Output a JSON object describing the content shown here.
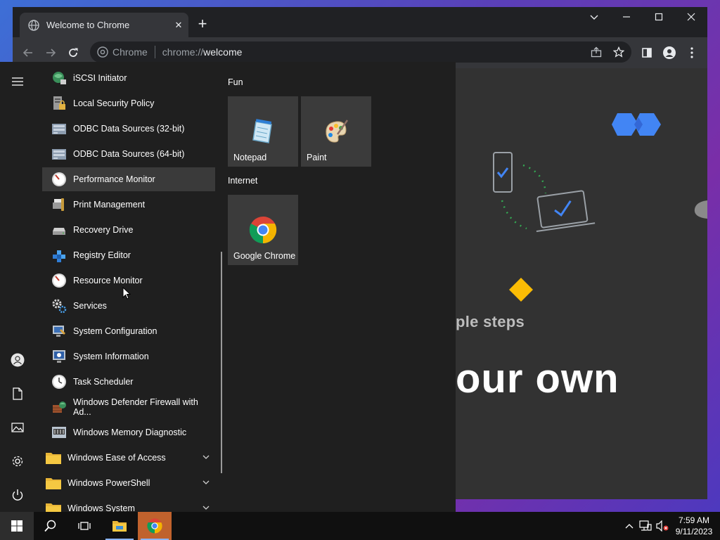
{
  "browser": {
    "tab_title": "Welcome to Chrome",
    "omnibox_site": "Chrome",
    "url_scheme": "chrome://",
    "url_host": "welcome",
    "icons": [
      "globe-icon",
      "close-icon",
      "plus-icon",
      "chevron-down-icon",
      "minimize-icon",
      "maximize-icon",
      "close-window-icon",
      "back-icon",
      "forward-icon",
      "reload-icon",
      "share-icon",
      "star-icon",
      "side-panel-icon",
      "profile-icon",
      "kebab-menu-icon"
    ]
  },
  "page": {
    "text_line1": "ple steps",
    "text_line2": "our own",
    "accent_blue": "#4285f4",
    "accent_yellow": "#fbbc04"
  },
  "start_menu": {
    "apps": [
      {
        "label": "iSCSI Initiator",
        "icon": "globe-network-icon"
      },
      {
        "label": "Local Security Policy",
        "icon": "security-policy-icon"
      },
      {
        "label": "ODBC Data Sources (32-bit)",
        "icon": "database-icon"
      },
      {
        "label": "ODBC Data Sources (64-bit)",
        "icon": "database-icon"
      },
      {
        "label": "Performance Monitor",
        "icon": "gauge-icon"
      },
      {
        "label": "Print Management",
        "icon": "printer-icon"
      },
      {
        "label": "Recovery Drive",
        "icon": "drive-icon"
      },
      {
        "label": "Registry Editor",
        "icon": "registry-icon"
      },
      {
        "label": "Resource Monitor",
        "icon": "gauge-icon"
      },
      {
        "label": "Services",
        "icon": "gear-icon"
      },
      {
        "label": "System Configuration",
        "icon": "monitor-icon"
      },
      {
        "label": "System Information",
        "icon": "info-monitor-icon"
      },
      {
        "label": "Task Scheduler",
        "icon": "clock-icon"
      },
      {
        "label": "Windows Defender Firewall with Ad...",
        "icon": "firewall-icon"
      },
      {
        "label": "Windows Memory Diagnostic",
        "icon": "memory-icon"
      }
    ],
    "folders": [
      {
        "label": "Windows Ease of Access"
      },
      {
        "label": "Windows PowerShell"
      },
      {
        "label": "Windows System"
      }
    ],
    "groups": [
      {
        "label": "Fun",
        "tiles": [
          {
            "label": "Notepad"
          },
          {
            "label": "Paint"
          }
        ]
      },
      {
        "label": "Internet",
        "tiles": [
          {
            "label": "Google Chrome"
          }
        ]
      }
    ],
    "rail_icons": [
      "hamburger-menu-icon",
      "user-icon",
      "document-icon",
      "pictures-icon",
      "settings-icon",
      "power-icon"
    ]
  },
  "taskbar": {
    "time": "7:59 AM",
    "date": "9/11/2023",
    "icons": [
      "windows-start-icon",
      "search-icon",
      "task-view-icon",
      "file-explorer-icon",
      "chrome-icon",
      "chevron-up-icon",
      "network-icon",
      "volume-muted-icon"
    ]
  }
}
